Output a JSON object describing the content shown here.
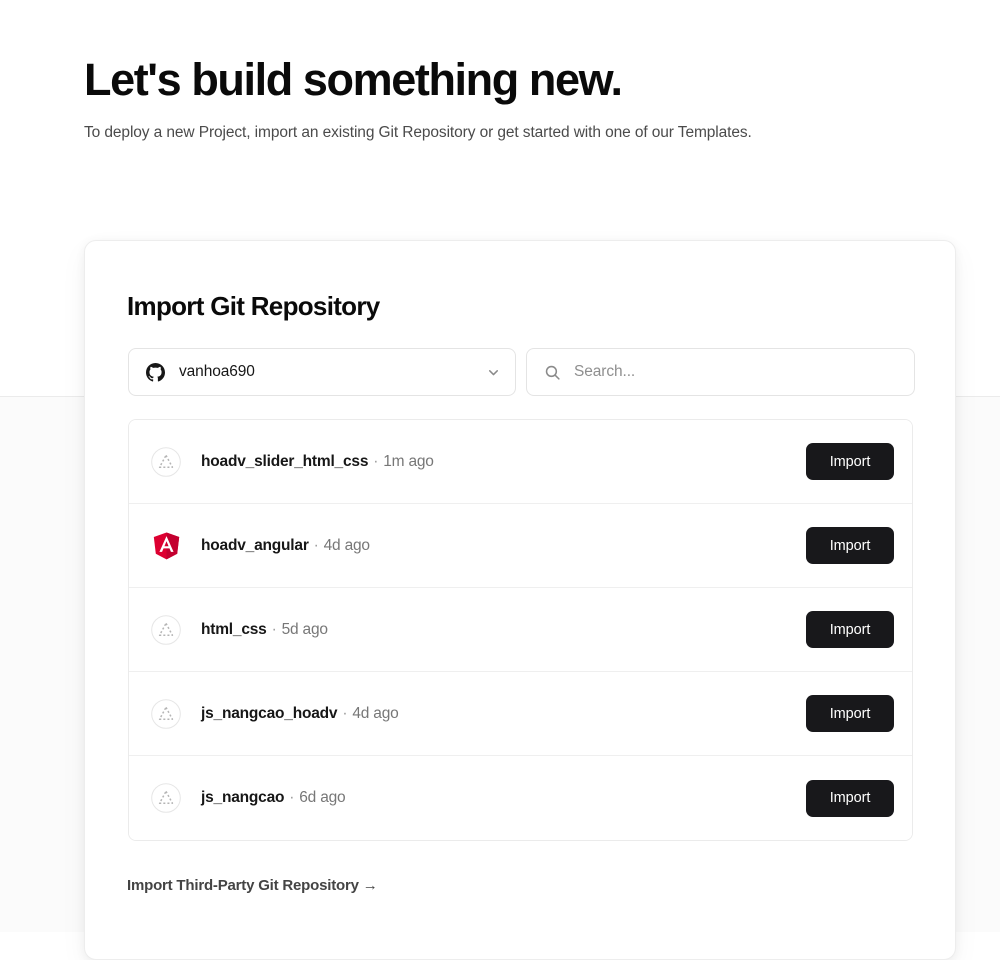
{
  "hero": {
    "title": "Let's build something new.",
    "subtitle": "To deploy a new Project, import an existing Git Repository or get started with one of our Templates."
  },
  "card": {
    "title": "Import Git Repository",
    "account_select": {
      "icon": "github-icon",
      "value": "vanhoa690",
      "chevron": "chevron-down-icon"
    },
    "search": {
      "icon": "search-icon",
      "value": "",
      "placeholder": "Search..."
    },
    "repositories": [
      {
        "name": "hoadv_slider_html_css",
        "separator": "·",
        "time": "1m ago",
        "icon": "placeholder-triangle-icon",
        "import_label": "Import"
      },
      {
        "name": "hoadv_angular",
        "separator": "·",
        "time": "4d ago",
        "icon": "angular-icon",
        "import_label": "Import"
      },
      {
        "name": "html_css",
        "separator": "·",
        "time": "5d ago",
        "icon": "placeholder-triangle-icon",
        "import_label": "Import"
      },
      {
        "name": "js_nangcao_hoadv",
        "separator": "·",
        "time": "4d ago",
        "icon": "placeholder-triangle-icon",
        "import_label": "Import"
      },
      {
        "name": "js_nangcao",
        "separator": "·",
        "time": "6d ago",
        "icon": "placeholder-triangle-icon",
        "import_label": "Import"
      }
    ],
    "third_party_link": "Import Third-Party Git Repository →"
  },
  "colors": {
    "page_background": "#ffffff",
    "page_background_lower": "#fbfbfb",
    "text_primary": "#0a0a0a",
    "text_secondary": "#4b4b4b",
    "text_muted": "#777777",
    "border": "#ebebeb",
    "button_background": "#18181b",
    "button_text": "#ffffff",
    "angular_red": "#dd0031"
  }
}
